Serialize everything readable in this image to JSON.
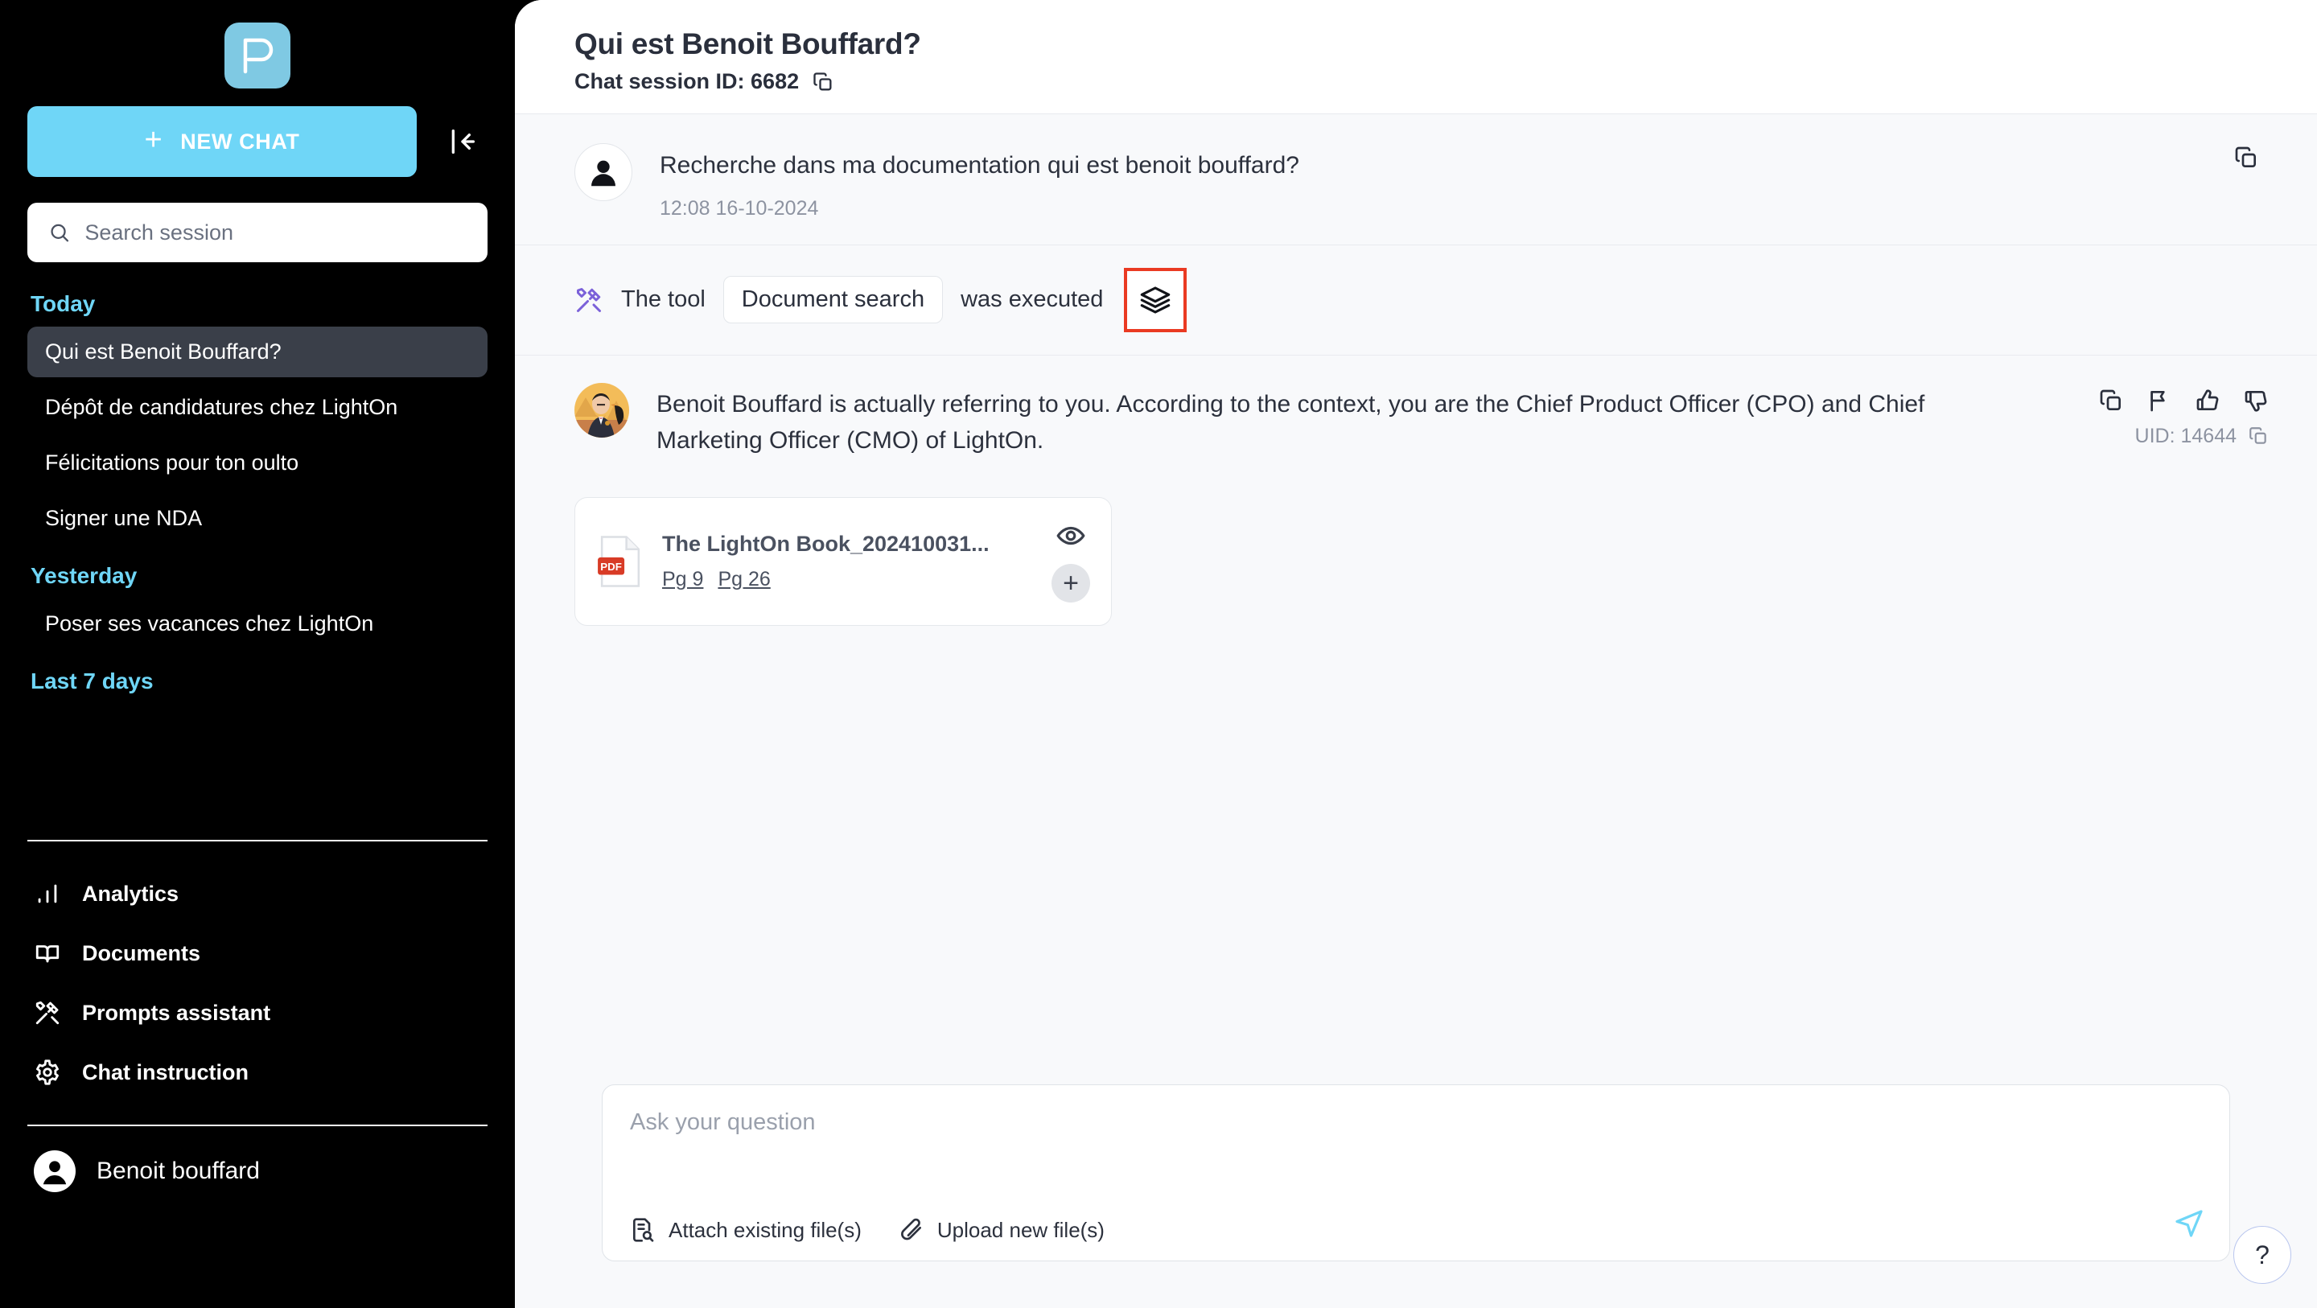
{
  "brand": {
    "logo_letter": "P",
    "logo_bg": "#7FC9E3",
    "accent": "#6FD6F7",
    "highlight_box": "#ea3a22"
  },
  "sidebar": {
    "new_chat_label": "NEW CHAT",
    "collapse_icon": "collapse-sidebar-icon",
    "search": {
      "placeholder": "Search session",
      "value": "",
      "icon": "search-icon"
    },
    "groups": [
      {
        "title": "Today",
        "items": [
          {
            "label": "Qui est Benoit Bouffard?",
            "active": true
          },
          {
            "label": "Dépôt de candidatures chez LightOn",
            "active": false
          },
          {
            "label": "Félicitations pour ton oulto",
            "active": false
          },
          {
            "label": "Signer une NDA",
            "active": false
          }
        ]
      },
      {
        "title": "Yesterday",
        "items": [
          {
            "label": "Poser ses vacances chez LightOn",
            "active": false
          }
        ]
      },
      {
        "title": "Last 7 days",
        "items": []
      }
    ],
    "nav": [
      {
        "label": "Analytics",
        "icon": "bar-chart-icon"
      },
      {
        "label": "Documents",
        "icon": "book-icon"
      },
      {
        "label": "Prompts assistant",
        "icon": "tools-icon"
      },
      {
        "label": "Chat instruction",
        "icon": "gear-icon"
      }
    ],
    "profile": {
      "name": "Benoit bouffard",
      "icon": "user-avatar-icon"
    }
  },
  "header": {
    "title": "Qui est Benoit Bouffard?",
    "session_id_label": "Chat session ID: 6682",
    "copy_icon": "copy-icon"
  },
  "conversation": {
    "user_message": {
      "text": "Recherche dans ma documentation qui est benoit bouffard?",
      "timestamp": "12:08 16-10-2024",
      "copy_icon": "copy-icon"
    },
    "tool_event": {
      "prefix": "The tool",
      "tool_name": "Document search",
      "suffix": "was executed",
      "tools_icon": "tools-icon",
      "layers_icon": "layers-icon"
    },
    "assistant_message": {
      "text": "Benoit Bouffard is actually referring to you. According to the context, you are the Chief Product Officer (CPO) and Chief Marketing Officer (CMO) of LightOn.",
      "actions": [
        {
          "icon": "copy-icon"
        },
        {
          "icon": "flag-icon"
        },
        {
          "icon": "thumbs-up-icon"
        },
        {
          "icon": "thumbs-down-icon"
        }
      ],
      "uid_label": "UID: 14644",
      "uid_copy_icon": "copy-icon"
    },
    "source_document": {
      "file_type": "PDF",
      "name": "The LightOn Book_202410031...",
      "pages": [
        "Pg 9",
        "Pg 26"
      ],
      "preview_icon": "eye-icon",
      "add_icon": "plus-icon"
    }
  },
  "composer": {
    "placeholder": "Ask your question",
    "value": "",
    "attach_existing_label": "Attach existing file(s)",
    "attach_existing_icon": "file-search-icon",
    "upload_new_label": "Upload new file(s)",
    "upload_new_icon": "paperclip-icon",
    "send_icon": "send-icon"
  },
  "help": {
    "label": "?"
  }
}
